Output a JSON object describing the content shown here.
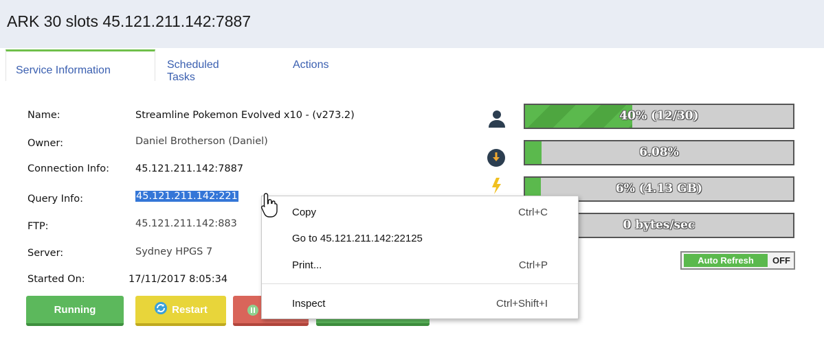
{
  "page": {
    "title": "ARK 30 slots 45.121.211.142:7887"
  },
  "tabs": [
    {
      "label": "Service Information"
    },
    {
      "label": "Scheduled Tasks"
    },
    {
      "label": "Actions"
    }
  ],
  "info": {
    "name_label": "Name:",
    "name_value": "Streamline Pokemon Evolved x10 - (v273.2)",
    "owner_label": "Owner:",
    "owner_value": "Daniel Brotherson (Daniel)",
    "connection_label": "Connection Info:",
    "connection_value": "45.121.211.142:7887",
    "query_label": "Query Info:",
    "query_value": "45.121.211.142:221",
    "ftp_label": "FTP:",
    "ftp_value": "45.121.211.142:883",
    "server_label": "Server:",
    "server_value": "Sydney HPGS 7",
    "started_label": "Started On:",
    "started_value": "17/11/2017 8:05:34"
  },
  "buttons": {
    "running": "Running",
    "restart": "Restart"
  },
  "stats": {
    "players": {
      "text": "40% (12/30)",
      "fill": 0.4,
      "icon": "players-icon"
    },
    "cpu": {
      "text": "6.08%",
      "fill": 0.0608,
      "icon": "cpu-icon"
    },
    "memory": {
      "text": "6% (4.13 GB)",
      "fill": 0.06,
      "icon": "memory-icon"
    },
    "network": {
      "text": "0 bytes/sec",
      "fill": 0
    }
  },
  "auto_refresh": {
    "label": "Auto Refresh",
    "state": "OFF"
  },
  "context_menu": {
    "copy": {
      "label": "Copy",
      "shortcut": "Ctrl+C"
    },
    "goto": {
      "label": "Go to 45.121.211.142:22125"
    },
    "print": {
      "label": "Print...",
      "shortcut": "Ctrl+P"
    },
    "inspect": {
      "label": "Inspect",
      "shortcut": "Ctrl+Shift+I"
    }
  },
  "colors": {
    "accent_green": "#5bb94d",
    "tab_link": "#3a5fb0",
    "selection": "#3476d7",
    "restart_yellow": "#e8d53a",
    "stop_red": "#d9655a"
  }
}
